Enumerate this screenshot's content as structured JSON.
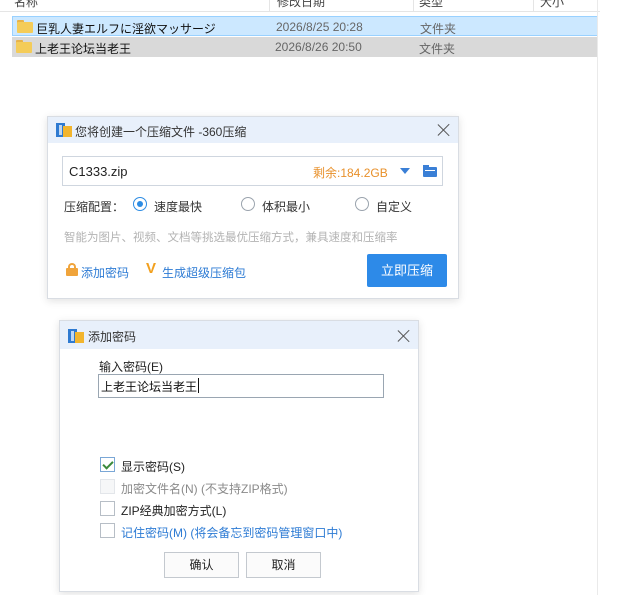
{
  "explorer": {
    "header": {
      "col_name": "名称",
      "col_date": "修改日期",
      "col_type": "类型",
      "col_size": "大小"
    },
    "rows": [
      {
        "name": "巨乳人妻エルフに淫欲マッサージ",
        "date": "2026/8/25 20:28",
        "type": "文件夹"
      },
      {
        "name": "上老王论坛当老王",
        "date": "2026/8/26 20:50",
        "type": "文件夹"
      }
    ]
  },
  "compress_dialog": {
    "title": "您将创建一个压缩文件 -360压缩",
    "filename": "C1333.zip",
    "remaining": "剩余:184.2GB",
    "config_label": "压缩配置：",
    "options": [
      {
        "label": "速度最快",
        "selected": true
      },
      {
        "label": "体积最小",
        "selected": false
      },
      {
        "label": "自定义",
        "selected": false
      }
    ],
    "hint": "智能为图片、视频、文档等挑选最优压缩方式，兼具速度和压缩率",
    "add_password_link": "添加密码",
    "super_package_link": "生成超级压缩包",
    "compress_button": "立即压缩"
  },
  "password_dialog": {
    "title": "添加密码",
    "input_label": "输入密码(E)",
    "input_value": "上老王论坛当老王",
    "checkboxes": [
      {
        "label": "显示密码(S)",
        "checked": true,
        "disabled": false
      },
      {
        "label": "加密文件名(N) (不支持ZIP格式)",
        "checked": false,
        "disabled": true
      },
      {
        "label": "ZIP经典加密方式(L)",
        "checked": false,
        "disabled": false
      },
      {
        "label": "记住密码(M) (将会备忘到密码管理窗口中)",
        "checked": false,
        "disabled": false
      }
    ],
    "ok_button": "确认",
    "cancel_button": "取消"
  },
  "colors": {
    "selection": "#cce8ff",
    "accent_blue": "#2d8ae8",
    "orange": "#e8902a",
    "folder_yellow": "#f4cc59"
  }
}
